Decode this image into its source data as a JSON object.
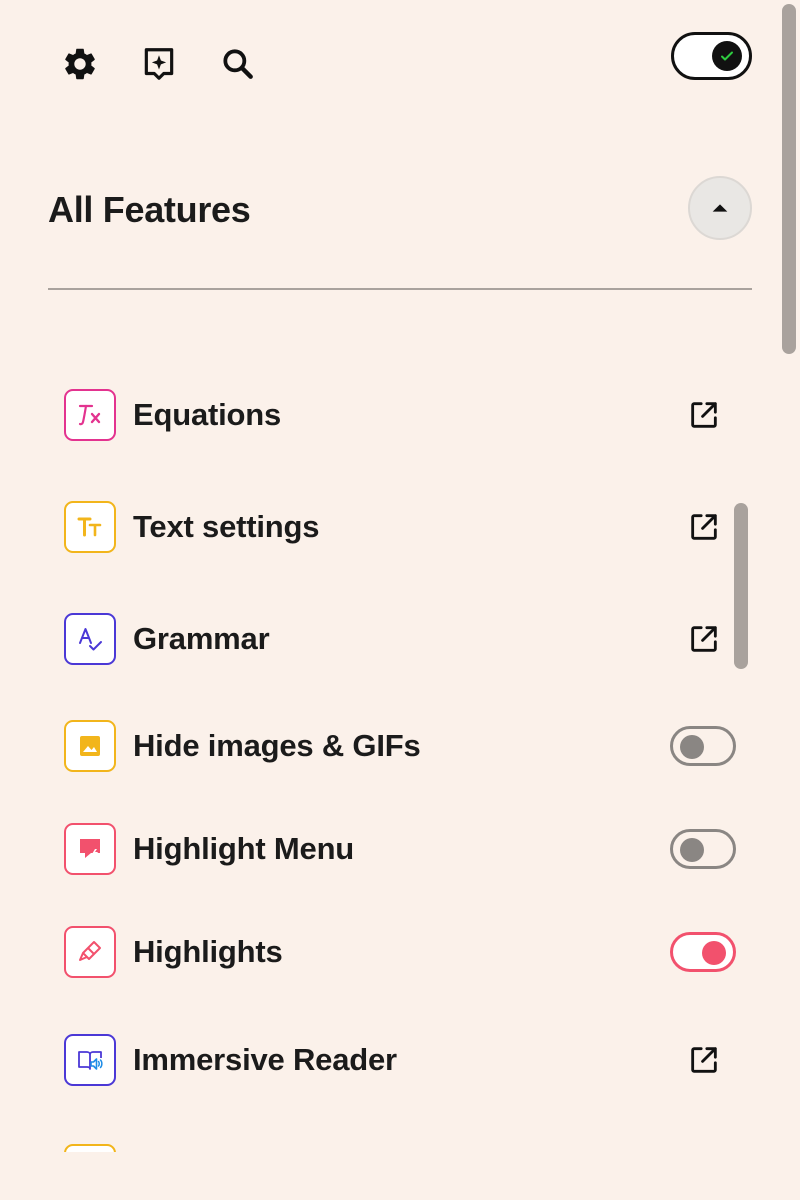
{
  "toolbar": {
    "settings_icon": "gear-icon",
    "ai_icon": "sparkle-tag-icon",
    "search_icon": "search-icon"
  },
  "master_toggle": {
    "state": "on",
    "color": "#111111",
    "check_color": "#2ECC40"
  },
  "section": {
    "title": "All Features",
    "collapse_icon": "caret-up-icon"
  },
  "features": [
    {
      "label": "Equations",
      "icon": "equation-icon",
      "accent": "#E3338F",
      "control": "open",
      "control_icon": "open-external-icon"
    },
    {
      "label": "Text settings",
      "icon": "text-size-icon",
      "accent": "#F2B51B",
      "control": "open",
      "control_icon": "open-external-icon"
    },
    {
      "label": "Grammar",
      "icon": "spellcheck-icon",
      "accent": "#4B38D6",
      "control": "open",
      "control_icon": "open-external-icon"
    },
    {
      "label": "Hide images & GIFs",
      "icon": "image-icon",
      "accent": "#F2B51B",
      "control": "toggle",
      "state": "off"
    },
    {
      "label": "Highlight Menu",
      "icon": "highlight-menu-icon",
      "accent": "#F2516D",
      "control": "toggle",
      "state": "off"
    },
    {
      "label": "Highlights",
      "icon": "highlighter-icon",
      "accent": "#F2516D",
      "control": "toggle",
      "state": "on"
    },
    {
      "label": "Immersive Reader",
      "icon": "immersive-reader-icon",
      "accent": "#4B38D6",
      "control": "open",
      "control_icon": "open-external-icon"
    }
  ],
  "colors": {
    "background": "#FBF1EA",
    "toggle_on": "#F2516D",
    "toggle_off": "#8A8683",
    "scrollbar": "#A9A29D"
  }
}
